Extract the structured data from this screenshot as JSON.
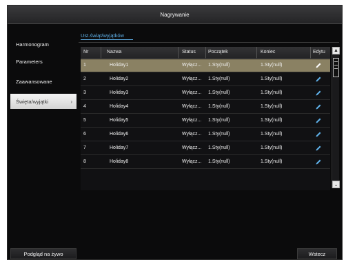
{
  "window": {
    "title": "Nagrywanie"
  },
  "sidebar": {
    "items": [
      {
        "label": "Harmonogram",
        "active": false
      },
      {
        "label": "Parameters",
        "active": false
      },
      {
        "label": "Zaawansowane",
        "active": false
      },
      {
        "label": "Święta/wyjątki",
        "active": true,
        "chevron": "›"
      }
    ]
  },
  "tab": {
    "label": "Ust.świąt/wyjątków"
  },
  "table": {
    "columns": [
      "Nr",
      "Nazwa",
      "Status",
      "Początek",
      "Koniec",
      "Edytu"
    ],
    "rows": [
      {
        "nr": "1",
        "name": "Holiday1",
        "status": "Wyłącz...",
        "start": "1.Sty(null)",
        "end": "1.Sty(null)"
      },
      {
        "nr": "2",
        "name": "Holiday2",
        "status": "Wyłącz...",
        "start": "1.Sty(null)",
        "end": "1.Sty(null)"
      },
      {
        "nr": "3",
        "name": "Holiday3",
        "status": "Wyłącz...",
        "start": "1.Sty(null)",
        "end": "1.Sty(null)"
      },
      {
        "nr": "4",
        "name": "Holiday4",
        "status": "Wyłącz...",
        "start": "1.Sty(null)",
        "end": "1.Sty(null)"
      },
      {
        "nr": "5",
        "name": "Holiday5",
        "status": "Wyłącz...",
        "start": "1.Sty(null)",
        "end": "1.Sty(null)"
      },
      {
        "nr": "6",
        "name": "Holiday6",
        "status": "Wyłącz...",
        "start": "1.Sty(null)",
        "end": "1.Sty(null)"
      },
      {
        "nr": "7",
        "name": "Holiday7",
        "status": "Wyłącz...",
        "start": "1.Sty(null)",
        "end": "1.Sty(null)"
      },
      {
        "nr": "8",
        "name": "Holiday8",
        "status": "Wyłącz...",
        "start": "1.Sty(null)",
        "end": "1.Sty(null)"
      }
    ],
    "selected_row": 1,
    "edit_icon": "pencil-icon"
  },
  "scrollbar": {
    "up": "▲",
    "down": "⌄"
  },
  "footer": {
    "live_view_label": "Podgląd na żywo",
    "back_label": "Wstecz"
  },
  "colors": {
    "accent": "#5fb0e8",
    "selected_row": "#8a8163",
    "background": "#0b0b0c"
  }
}
